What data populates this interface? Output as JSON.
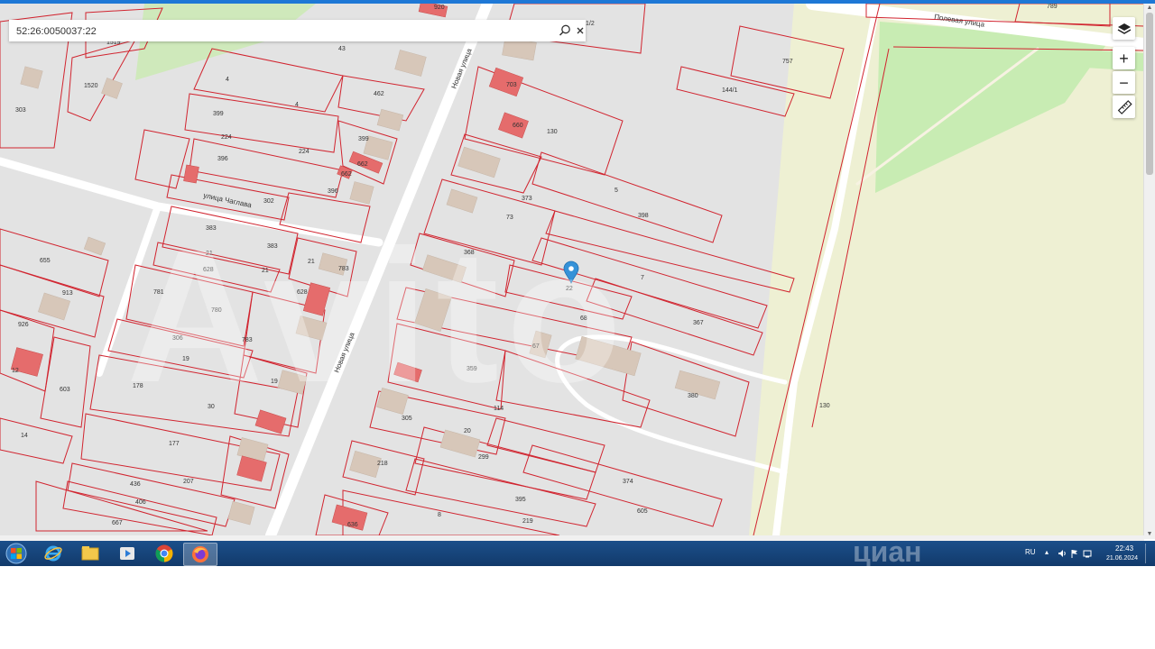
{
  "search": {
    "value": "52:26:0050037:22"
  },
  "streets": {
    "novaya_1": "Новая улица",
    "novaya_2": "Новая улица",
    "polevaya": "Полевая улица",
    "chaglava": "улица Чаглава"
  },
  "map": {
    "parcel_labels": [
      "1519",
      "1520",
      "303",
      "4",
      "462",
      "399",
      "43",
      "4",
      "224",
      "399",
      "224",
      "396",
      "662",
      "662",
      "302",
      "396",
      "783",
      "383",
      "655",
      "21",
      "383",
      "628",
      "21",
      "21",
      "913",
      "781",
      "780",
      "628",
      "926",
      "306",
      "783",
      "19",
      "12",
      "603",
      "178",
      "30",
      "19",
      "14",
      "177",
      "207",
      "436",
      "406",
      "667",
      "703",
      "660",
      "1/2",
      "920",
      "130",
      "5",
      "373",
      "73",
      "398",
      "368",
      "7",
      "22",
      "367",
      "68",
      "67",
      "359",
      "380",
      "114",
      "305",
      "20",
      "299",
      "218",
      "374",
      "395",
      "605",
      "219",
      "8",
      "636",
      "757",
      "144/1",
      "130",
      "789"
    ],
    "marker": "selected-parcel-marker"
  },
  "map_controls": {
    "layers": "layers-icon",
    "zoom_in": "+",
    "zoom_out": "−",
    "ruler": "ruler-icon"
  },
  "watermark": {
    "avito": "Avito",
    "cian": "циан"
  },
  "taskbar": {
    "apps": [
      "start-orb",
      "internet-explorer",
      "file-explorer",
      "media-player",
      "chrome",
      "firefox"
    ],
    "lang": "RU",
    "time": "22:43",
    "date": "21.06.2024"
  },
  "colors": {
    "parcel_border": "#d1242f",
    "building": "#e66b6b",
    "road": "#ffffff",
    "field": "#eef0d3",
    "grass": "#c5eab0",
    "taskbar": "#123a6b"
  }
}
